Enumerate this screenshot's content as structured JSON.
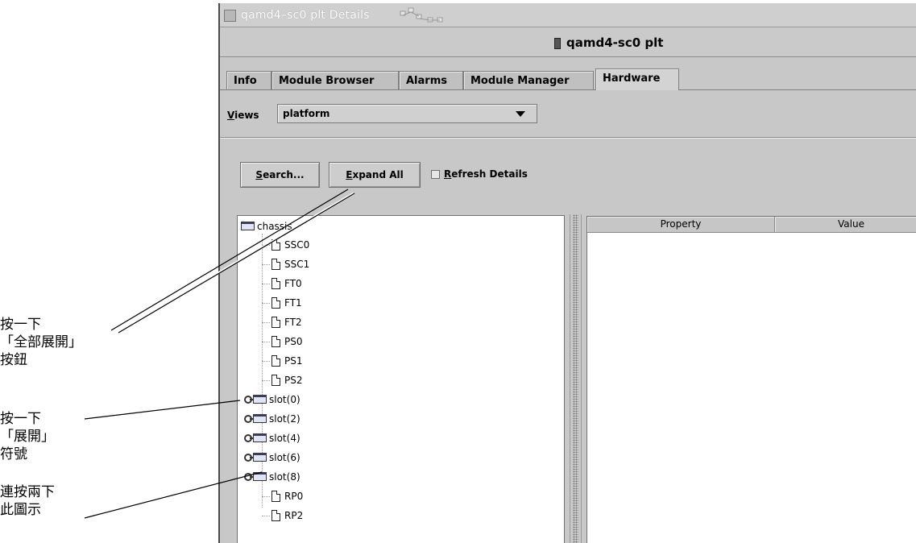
{
  "window": {
    "title": "qamd4–sc0 plt Details",
    "host_label": "qamd4-sc0 plt"
  },
  "tabs": [
    {
      "label": "Info",
      "active": false
    },
    {
      "label": "Module Browser",
      "active": false
    },
    {
      "label": "Alarms",
      "active": false
    },
    {
      "label": "Module Manager",
      "active": false
    },
    {
      "label": "Hardware",
      "active": true
    }
  ],
  "views": {
    "label_mnemonic": "V",
    "label_rest": "iews",
    "selected": "platform"
  },
  "toolbar": {
    "search_mnemonic": "S",
    "search_rest": "earch...",
    "expand_mnemonic": "E",
    "expand_rest": "xpand All",
    "refresh_mnemonic": "R",
    "refresh_rest": "efresh Details",
    "refresh_checked": false
  },
  "tree": {
    "root": "chassis",
    "leaves_top": [
      "SSC0",
      "SSC1",
      "FT0",
      "FT1",
      "FT2",
      "PS0",
      "PS1",
      "PS2"
    ],
    "slots": [
      "slot(0)",
      "slot(2)",
      "slot(4)",
      "slot(6)",
      "slot(8)"
    ],
    "leaves_bottom": [
      "RP0",
      "RP2"
    ]
  },
  "properties": {
    "columns": [
      "Property",
      "Value"
    ]
  },
  "callouts": {
    "expand_all": [
      "按一下",
      "「全部展開」",
      "按鈕"
    ],
    "expand_symbol": [
      "按一下",
      "「展開」",
      "符號"
    ],
    "double_click": [
      "連按兩下",
      "此圖示"
    ]
  }
}
